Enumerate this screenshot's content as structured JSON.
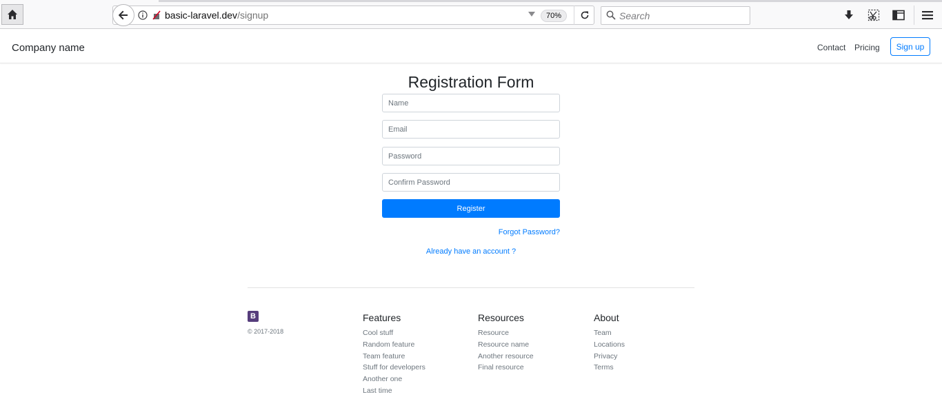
{
  "browser": {
    "url_domain": "basic-laravel.dev",
    "url_path": "/signup",
    "zoom": "70%",
    "search_placeholder": "Search"
  },
  "navbar": {
    "brand": "Company name",
    "links": [
      "Contact",
      "Pricing"
    ],
    "signup_label": "Sign up"
  },
  "form": {
    "title": "Registration Form",
    "fields": [
      {
        "placeholder": "Name"
      },
      {
        "placeholder": "Email"
      },
      {
        "placeholder": "Password"
      },
      {
        "placeholder": "Confirm Password"
      }
    ],
    "register_label": "Register",
    "forgot_label": "Forgot Password?",
    "account_label": "Already have an account ?"
  },
  "footer": {
    "logo_letter": "B",
    "copyright": "© 2017-2018",
    "columns": [
      {
        "title": "Features",
        "items": [
          "Cool stuff",
          "Random feature",
          "Team feature",
          "Stuff for developers",
          "Another one",
          "Last time"
        ]
      },
      {
        "title": "Resources",
        "items": [
          "Resource",
          "Resource name",
          "Another resource",
          "Final resource"
        ]
      },
      {
        "title": "About",
        "items": [
          "Team",
          "Locations",
          "Privacy",
          "Terms"
        ]
      }
    ]
  },
  "colors": {
    "primary": "#007bff",
    "bootstrap_purple": "#563d7c"
  }
}
